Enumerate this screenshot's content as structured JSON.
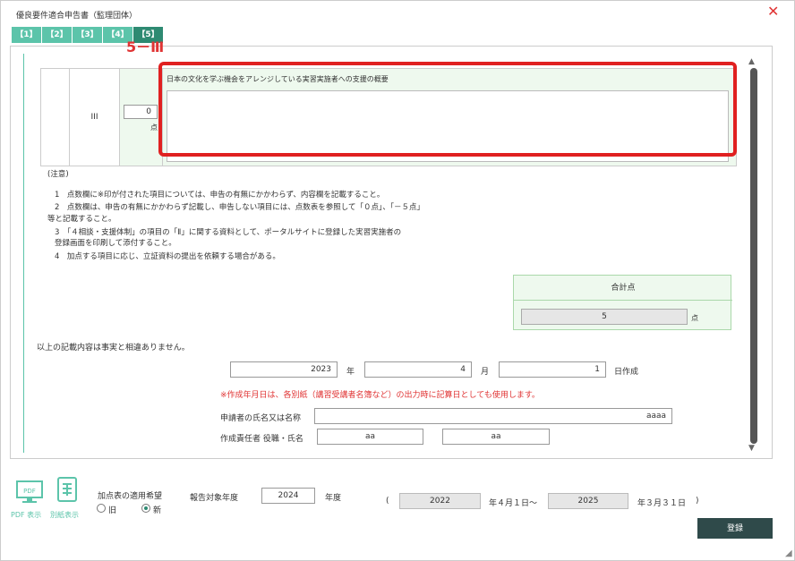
{
  "window": {
    "title": "優良要件適合申告書（監理団体）",
    "close_label": "✕"
  },
  "tabs": [
    "【1】",
    "【2】",
    "【3】",
    "【4】",
    "【5】"
  ],
  "annotation": "5－Ⅲ",
  "row": {
    "label": "III",
    "score_value": "0",
    "score_unit": "点",
    "desc_label": "日本の文化を学ぶ機会をアレンジしている実習実施者への支援の概要",
    "desc_value": ""
  },
  "notes": {
    "heading": "(注意)",
    "items": [
      "1　点数欄に※印が付された項目については、申告の有無にかかわらず、内容欄を記載すること。",
      "2　点数欄は、申告の有無にかかわらず記載し、申告しない項目には、点数表を参照して「０点」、「－５点」",
      "等と記載すること。",
      "3　「４相談・支援体制」の項目の「Ⅱ」に関する資料として、ポータルサイトに登録した実習実施者の",
      "登録画面を印刷して添付すること。",
      "4　加点する項目に応じ、立証資料の提出を依頼する場合がある。"
    ]
  },
  "total": {
    "label": "合計点",
    "value": "5",
    "unit": "点"
  },
  "declaration": "以上の記載内容は事実と相違ありません。",
  "date": {
    "year": "2023",
    "year_label": "年",
    "month": "4",
    "month_label": "月",
    "day": "1",
    "day_label": "日作成"
  },
  "date_note": "※作成年月日は、各別紙（講習受講者名簿など）の出力時に記算日としても使用します。",
  "applicant": {
    "label": "申請者の氏名又は名称",
    "value": "aaaa"
  },
  "creator": {
    "label": "作成責任者 役職・氏名",
    "title_value": "aa",
    "name_value": "aa"
  },
  "bottom": {
    "pdf_label": "PDF 表示",
    "sheet_label": "別紙表示",
    "pdf_icon_text": "PDF",
    "scoring_label": "加点表の適用希望",
    "radio_old": "旧",
    "radio_new": "新",
    "report_year_label": "報告対象年度",
    "report_year": "2024",
    "report_year_unit": "年度",
    "open_paren": "(",
    "period_start": "2022",
    "period_start_label": "年４月１日～",
    "period_end": "2025",
    "period_end_label": "年３月３１日",
    "close_paren": ")",
    "register_label": "登録"
  },
  "colors": {
    "accent": "#5cc4aa",
    "tab_active": "#2e8a72",
    "alert": "#e03434",
    "register": "#2f4a4a"
  }
}
